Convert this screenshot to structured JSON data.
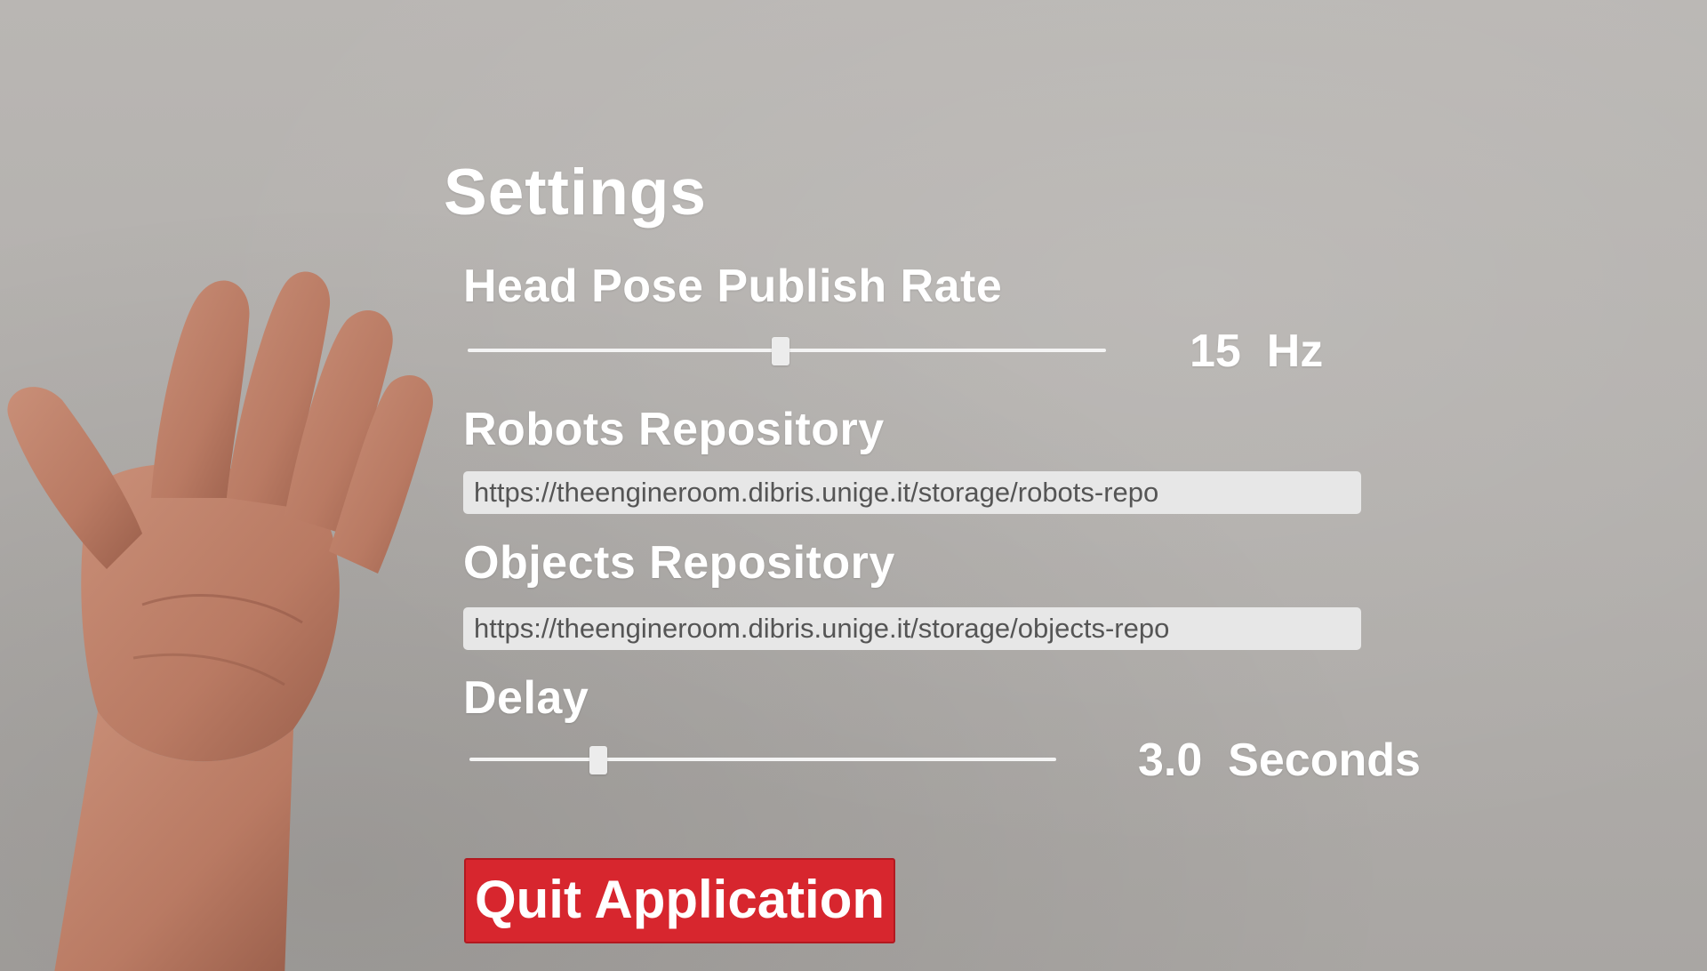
{
  "settings": {
    "title": "Settings",
    "head_pose": {
      "label": "Head Pose Publish Rate",
      "value": 15,
      "unit": "Hz",
      "display": "15  Hz",
      "slider_fraction": 0.49
    },
    "robots_repo": {
      "label": "Robots Repository",
      "url": "https://theengineroom.dibris.unige.it/storage/robots-repo"
    },
    "objects_repo": {
      "label": "Objects Repository",
      "url": "https://theengineroom.dibris.unige.it/storage/objects-repo"
    },
    "delay": {
      "label": "Delay",
      "value": 3.0,
      "unit": "Seconds",
      "display": "3.0  Seconds",
      "slider_fraction": 0.22
    },
    "quit_label": "Quit Application"
  },
  "colors": {
    "background": "#b4b1ae",
    "text": "#ffffff",
    "quit_button": "#d7262e",
    "field_bg": "#e7e7e7"
  },
  "icons": {
    "hand": "hand-icon"
  }
}
